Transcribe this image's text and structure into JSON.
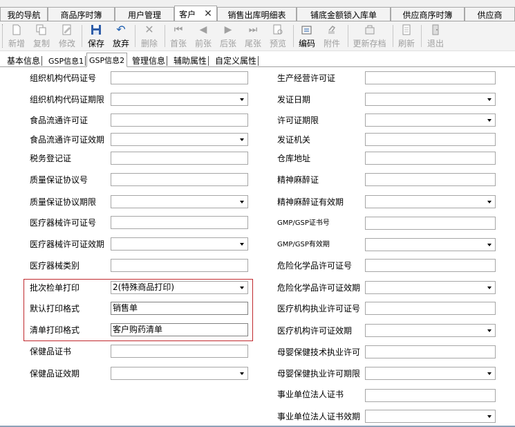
{
  "doc_tabs": [
    "我的导航",
    "商品序时簿",
    "用户管理",
    "客户",
    "销售出库明细表",
    "铺底金额锁入库单",
    "供应商序时簿",
    "供应商"
  ],
  "toolbar": {
    "new": "新增",
    "copy": "复制",
    "modify": "修改",
    "save": "保存",
    "discard": "放弃",
    "delete": "删除",
    "first": "首张",
    "prev": "前张",
    "next": "后张",
    "last": "尾张",
    "preview": "预览",
    "code": "编码",
    "attach": "附件",
    "update_archive": "更新存档",
    "refresh": "刷新",
    "exit": "退出"
  },
  "sub_tabs": [
    "基本信息",
    "GSP信息1",
    "GSP信息2",
    "管理信息",
    "辅助属性",
    "自定义属性"
  ],
  "left_fields": [
    {
      "label": "组织机构代码证号",
      "value": ""
    },
    {
      "label": "组织机构代码证期限",
      "value": ""
    },
    {
      "label": "食品流通许可证",
      "value": ""
    },
    {
      "label": "食品流通许可证效期",
      "value": ""
    },
    {
      "label": "税务登记证",
      "value": ""
    },
    {
      "label": "质量保证协议号",
      "value": ""
    },
    {
      "label": "质量保证协议期限",
      "value": ""
    },
    {
      "label": "医疗器械许可证号",
      "value": ""
    },
    {
      "label": "医疗器械许可证效期",
      "value": ""
    },
    {
      "label": "医疗器械类别",
      "value": ""
    },
    {
      "label": "批次检单打印",
      "value": "2(特殊商品打印)"
    },
    {
      "label": "默认打印格式",
      "value": "销售单"
    },
    {
      "label": "清单打印格式",
      "value": "客户购药清单"
    },
    {
      "label": "保健品证书",
      "value": ""
    },
    {
      "label": "保健品证效期",
      "value": ""
    }
  ],
  "right_fields": [
    {
      "label": "生产经营许可证",
      "value": ""
    },
    {
      "label": "发证日期",
      "value": ""
    },
    {
      "label": "许可证期限",
      "value": ""
    },
    {
      "label": "发证机关",
      "value": ""
    },
    {
      "label": "仓库地址",
      "value": ""
    },
    {
      "label": "精神麻醉证",
      "value": ""
    },
    {
      "label": "精神麻醉证有效期",
      "value": ""
    },
    {
      "label": "GMP/GSP证书号",
      "value": ""
    },
    {
      "label": "GMP/GSP有效期",
      "value": ""
    },
    {
      "label": "危险化学品许可证号",
      "value": ""
    },
    {
      "label": "危险化学品许可证效期",
      "value": ""
    },
    {
      "label": "医疗机构执业许可证号",
      "value": ""
    },
    {
      "label": "医疗机构许可证效期",
      "value": ""
    },
    {
      "label": "母婴保健技术执业许可",
      "value": ""
    },
    {
      "label": "母婴保健执业许可期限",
      "value": ""
    },
    {
      "label": "事业单位法人证书",
      "value": ""
    },
    {
      "label": "事业单位法人证书效期",
      "value": ""
    }
  ],
  "colors": {
    "highlight_border": "#c0282d",
    "accent_blue": "#1f5fb0"
  }
}
